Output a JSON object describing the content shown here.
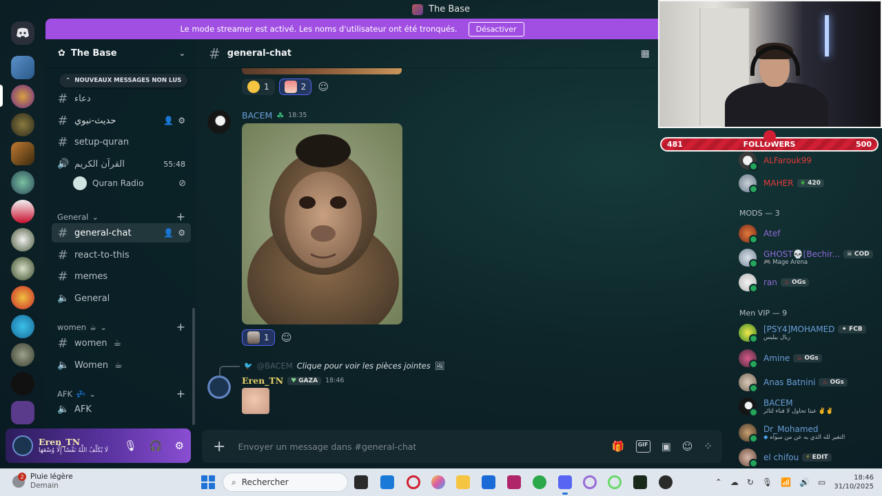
{
  "window": {
    "title": "The Base"
  },
  "banner": {
    "text": "Le mode streamer est activé. Les noms d'utilisateur ont été tronqués.",
    "button": "Désactiver"
  },
  "server": {
    "name": "The Base"
  },
  "sidebar": {
    "unread_pill": "NOUVEAUX MESSAGES NON LUS",
    "channels_top": [
      {
        "name": "دعاء"
      },
      {
        "name": "حديث-نبوي"
      },
      {
        "name": "setup-quran"
      },
      {
        "name": "القرآن الكريم",
        "timer": "55:48"
      }
    ],
    "voice_user": "Quran Radio",
    "categories": {
      "general": "General",
      "women": "women",
      "afk": "AFK"
    },
    "general_channels": [
      {
        "name": "general-chat"
      },
      {
        "name": "react-to-this"
      },
      {
        "name": "memes"
      },
      {
        "name": "General"
      }
    ],
    "women_channels": [
      {
        "name": "women"
      },
      {
        "name": "Women"
      }
    ],
    "afk_channels": [
      {
        "name": "AFK"
      }
    ]
  },
  "user_panel": {
    "name": "Eren_TN",
    "status": "لَا يُكَلِّفُ اللَّهُ نَفْسًا إِلَّا وُسْعَهَا"
  },
  "chat": {
    "channel": "general-chat",
    "top_reactions": [
      {
        "count": "1"
      },
      {
        "count": "2"
      }
    ],
    "msg1": {
      "author": "BACEM",
      "time": "18:35",
      "reaction_count": "1"
    },
    "reply": {
      "mention": "@BACEM",
      "text": "Clique pour voir les pièces jointes"
    },
    "msg2": {
      "author": "Eren_TN",
      "tag": "GAZA",
      "time": "18:46"
    },
    "composer_placeholder": "Envoyer un message dans #general-chat"
  },
  "followers": {
    "current": "481",
    "label": "FOLLOWERS",
    "goal": "500"
  },
  "members": {
    "top": [
      {
        "name": "ALFarouk99",
        "color": "#e23b3b"
      },
      {
        "name": "MAHER",
        "color": "#e23b3b",
        "tag": "420"
      }
    ],
    "mods_header": "MODS — 3",
    "mods": [
      {
        "name": "Atef",
        "color": "#8f6bd8"
      },
      {
        "name": "GHOST💀[Bechir...",
        "color": "#8f6bd8",
        "tag": "COD",
        "sub": "Mage Arena"
      },
      {
        "name": "ran",
        "color": "#8f6bd8",
        "tag": "OGs"
      }
    ],
    "vip_header": "Men VIP — 9",
    "vip": [
      {
        "name": "[PSY4]MOHAMED",
        "color": "#6b9fd8",
        "tag": "FCB",
        "sub": "ربال بيليس"
      },
      {
        "name": "Amine",
        "color": "#6b9fd8",
        "tag": "OGs"
      },
      {
        "name": "Anas Batnini",
        "color": "#6b9fd8",
        "tag": "OGs"
      },
      {
        "name": "BACEM",
        "color": "#6b9fd8",
        "sub": "عبثا تحاول لا فناء لثائر ✌️✌️"
      },
      {
        "name": "Dr_Mohamed",
        "color": "#6b9fd8",
        "sub": "التغير لله الذي به عن من سواه"
      },
      {
        "name": "el chifou",
        "color": "#6b9fd8",
        "tag": "EDIT"
      }
    ]
  },
  "taskbar": {
    "weather_title": "Pluie légère",
    "weather_sub": "Demain",
    "weather_badge": "2",
    "search_placeholder": "Rechercher",
    "time": "18:46",
    "date": "31/10/2025"
  }
}
